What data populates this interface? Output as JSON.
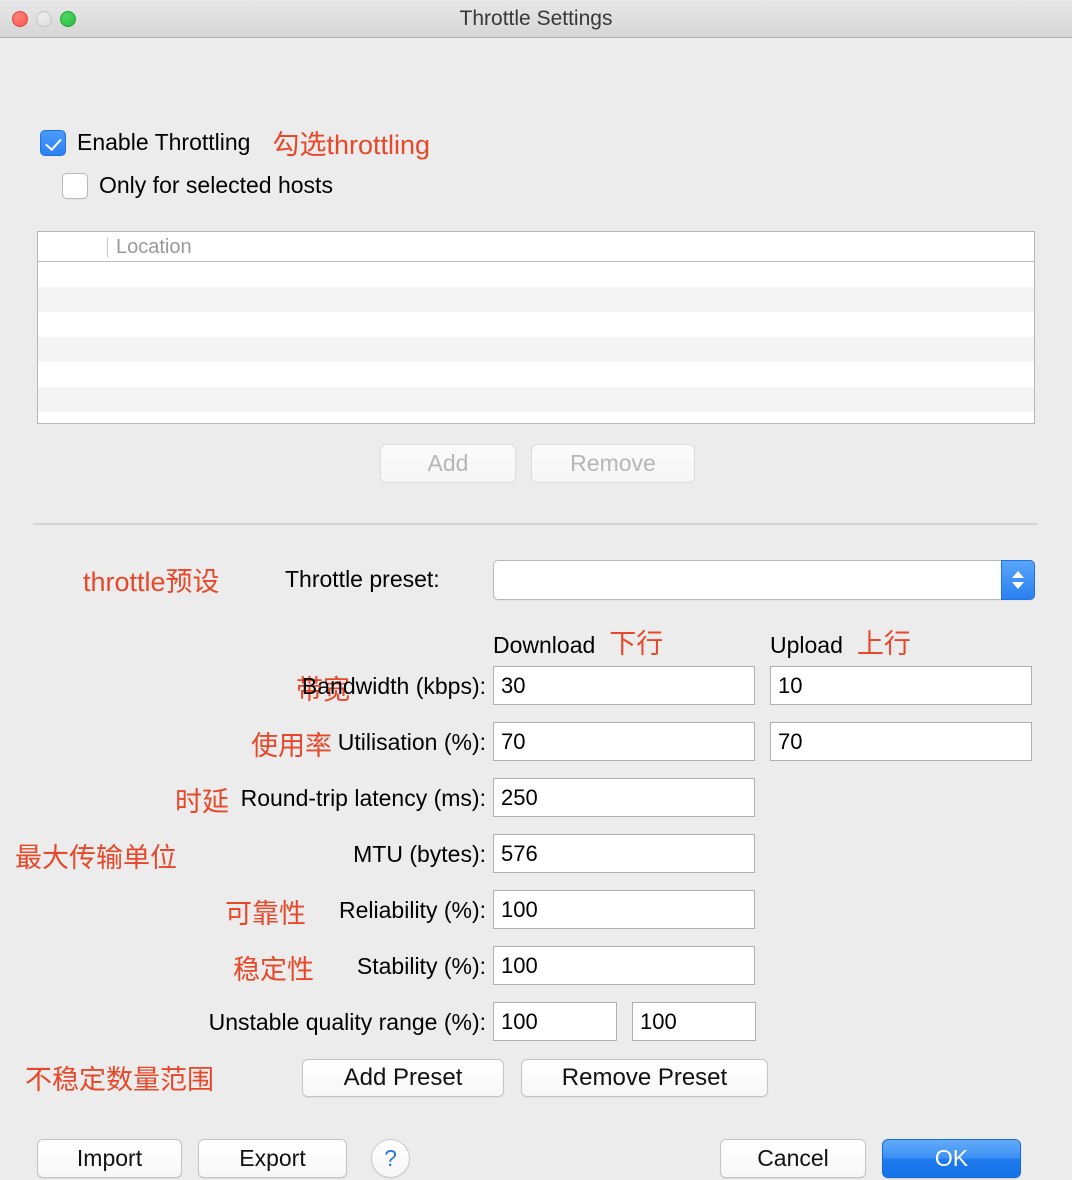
{
  "window": {
    "title": "Throttle Settings",
    "traffic_lights": [
      "close",
      "minimize",
      "maximize"
    ]
  },
  "colors": {
    "annotation_red": "#e8482a",
    "accent_blue": "#2d80f2",
    "ok_button_blue": "#1f7bee",
    "window_background": "#ececec"
  },
  "options": {
    "enable_throttling": {
      "label": "Enable Throttling",
      "checked": true,
      "annotation": "勾选throttling"
    },
    "only_selected_hosts": {
      "label": "Only for selected hosts",
      "checked": false
    }
  },
  "host_table": {
    "columns": [
      "",
      "Location"
    ],
    "rows": [],
    "empty_row_count": 5
  },
  "host_buttons": {
    "add": "Add",
    "remove": "Remove",
    "add_enabled": false,
    "remove_enabled": false
  },
  "preset": {
    "annotation": "throttle预设",
    "label": "Throttle preset:",
    "value": "",
    "options": []
  },
  "column_headers": {
    "download": {
      "label": "Download",
      "annotation": "下行"
    },
    "upload": {
      "label": "Upload",
      "annotation": "上行"
    }
  },
  "fields": [
    {
      "key": "bandwidth",
      "annotation": "带宽",
      "label": "Bandwidth (kbps):",
      "download": "30",
      "upload": "10",
      "two_column": true
    },
    {
      "key": "utilisation",
      "annotation": "使用率",
      "label": "Utilisation (%):",
      "download": "70",
      "upload": "70",
      "two_column": true
    },
    {
      "key": "latency",
      "annotation": "时延",
      "label": "Round-trip latency (ms):",
      "download": "250",
      "upload": null,
      "two_column": false
    },
    {
      "key": "mtu",
      "annotation": "最大传输单位",
      "label": "MTU (bytes):",
      "download": "576",
      "upload": null,
      "two_column": false
    },
    {
      "key": "reliability",
      "annotation": "可靠性",
      "label": "Reliability (%):",
      "download": "100",
      "upload": null,
      "two_column": false
    },
    {
      "key": "stability",
      "annotation": "稳定性",
      "label": "Stability (%):",
      "download": "100",
      "upload": null,
      "two_column": false
    }
  ],
  "unstable_range": {
    "annotation": "不稳定数量范围",
    "label": "Unstable quality range (%):",
    "min": "100",
    "max": "100"
  },
  "preset_buttons": {
    "add_preset": "Add Preset",
    "remove_preset": "Remove Preset"
  },
  "footer": {
    "import": "Import",
    "export": "Export",
    "help": "?",
    "cancel": "Cancel",
    "ok": "OK"
  }
}
